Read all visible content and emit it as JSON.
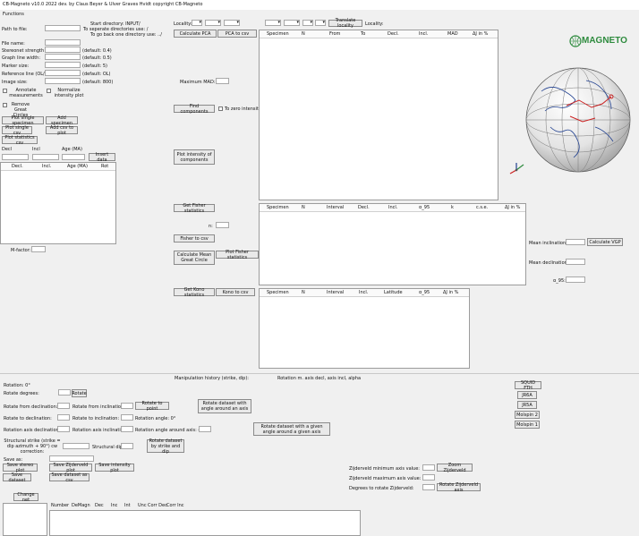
{
  "window": {
    "title": "CB-Magneto v10.0 2022 dev. by Claus Beyer & Ulver Graves Hvidt copyright CB-Magneto"
  },
  "menu": {
    "functions": "Functions"
  },
  "left": {
    "path_label": "Path to file:",
    "start_dir": "Start directory: INPUT/",
    "sep_dir": "To seperate directories use: /",
    "back_dir": "To go back one directory use: ../",
    "file_name": "File name:",
    "stereonet": "Stereonet strength",
    "stereonet_def": "(default: 0.4)",
    "graph_line": "Graph line width:",
    "graph_line_def": "(default: 0.5)",
    "marker": "Marker size:",
    "marker_def": "(default: 5)",
    "refline": "Reference line (OL/N):",
    "refline_def": "(default: OL)",
    "image_size": "Image size:",
    "image_size_def": "(default: 800)",
    "annotate": "Annotate measurements",
    "normalize": "Normalize intensity plot",
    "remove_gc": "Remove Great Circles",
    "plot_single": "Plot single specimen",
    "add_specimen": "Add specimen",
    "plot_single_csv": "Plot single csv",
    "add_csv": "Add csv to plot",
    "plot_stats_csv": "Plot statistics csv",
    "dec": "Decl",
    "inc": "Incl",
    "age": "Age (MA)",
    "insert_data": "Insert data",
    "table_headers": [
      "Decl.",
      "Incl.",
      "Age (MA)",
      "Rot"
    ],
    "mfactor": "M-factor:"
  },
  "mid": {
    "calc_pca": "Calculate PCA",
    "pca_to_csv": "PCA to csv",
    "max_mad": "Maximum MAD:",
    "find_components": "Find components",
    "to_zero": "To zero intensity",
    "plot_intensity": "Plot intensity of components",
    "get_fisher": "Get Fisher statistics",
    "n_label": "n:",
    "fisher_csv": "Fisher to csv",
    "calc_mean_gc": "Calculate Mean Great Circle",
    "plot_fisher": "Plot Fisher statistics",
    "get_kono": "Get Kono statistics",
    "kono_csv": "Kono to csv"
  },
  "locality": {
    "label": "Locality:",
    "translate": "Translate locality",
    "label2": "Locality:"
  },
  "pca_headers": [
    "Specimen",
    "N",
    "From",
    "To",
    "Decl.",
    "Incl.",
    "MAD",
    "ΔJ in %"
  ],
  "fisher_headers": [
    "Specimen",
    "N",
    "Interval",
    "Decl.",
    "Incl.",
    "α_95",
    "k",
    "c.s.e.",
    "ΔJ in %"
  ],
  "kono_headers": [
    "Specimen",
    "N",
    "Interval",
    "Incl.",
    "Latitude",
    "α_95",
    "ΔJ in %"
  ],
  "right": {
    "logo": "MAGNETO",
    "mean_inc": "Mean inclination:",
    "calc_vgp": "Calculate VGP",
    "mean_dec": "Mean declination:",
    "a95": "α_95:"
  },
  "bottom": {
    "manip_history": "Manipulation history (strike, dip):",
    "rotation_axis": "Rotation m. axis decl, axis incl, alpha",
    "rotation": "Rotation: 0°",
    "rotate_degrees": "Rotate degrees:",
    "rotate_btn": "Rotate",
    "rot_from_dec": "Rotate from declination:",
    "rot_from_inc": "Rotate from inclination:",
    "rot_to_point": "Rotate to point",
    "rot_to_dec": "Rotate to declination:",
    "rot_to_inc": "Rotate to inclination:",
    "rot_angle": "Rotation angle: 0°",
    "rot_axis_dec": "Rotation axis declination:",
    "rot_axis_inc": "Rotation axis inclination:",
    "rot_angle_axis": "Rotation angle around axis: (cw)",
    "rot_dataset_axis": "Rotate dataset with angle around an axis",
    "rot_dataset_given": "Rotate dataset with a given angle around a given axis",
    "struct_strike": "Structural strike (strike = dip azimuth + 90°) cw correction:",
    "struct_dip": "Structural dip:",
    "rot_strike_dip": "Rotate dataset by strike and dip",
    "save_as": "Save as:",
    "save_stereo": "Save stereo plot",
    "save_zijderveld": "Save Zijderveld plot",
    "save_intensity": "Save intensity plot",
    "save_dataset": "Save dataset",
    "save_dataset_csv": "Save dataset as csv",
    "change_net": "Change net",
    "squid": "SQUID FTH",
    "jr6a": "JR6A",
    "jr5a": "JR5A",
    "molspin2": "Molspin 2",
    "molspin1": "Molspin 1",
    "zij_min": "Zijderveld minimum axis value:",
    "zoom_zij": "Zoom Zijderveld",
    "zij_max": "Zijderveld maximum axis value:",
    "deg_rot_zij": "Degrees to rotate Zijderveld:",
    "rot_zij_axis": "Rotate Zijderveld axis",
    "data_headers": [
      "Number",
      "DeMagn",
      "Dec",
      "Inc",
      "Int",
      "Unc",
      "Corr Dec",
      "Corr Inc"
    ]
  },
  "colors": {
    "globe_track": "#cc2222",
    "logo_green": "#2e8b3e"
  }
}
